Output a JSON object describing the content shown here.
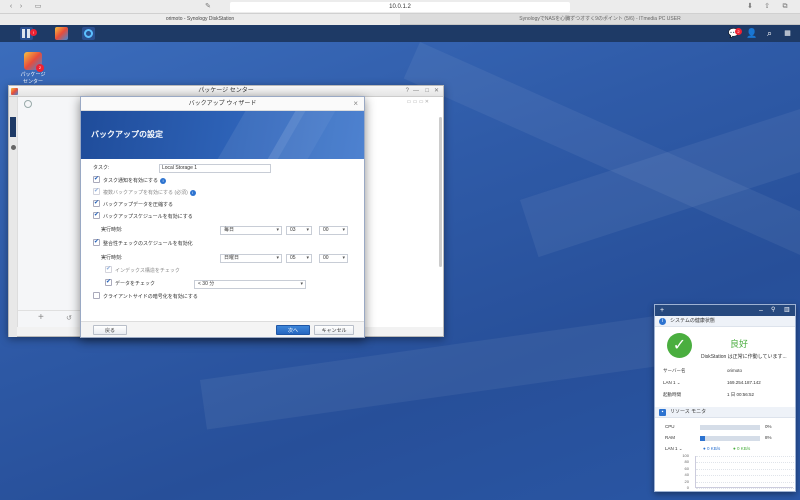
{
  "browser": {
    "address": "10.0.1.2",
    "tabs": [
      {
        "title": "orimoto - Synology DiskStation"
      },
      {
        "title": "SynologyでNASを心臓ずつオすく9のポイント (5/6) - ITmedia PC USER"
      }
    ]
  },
  "taskbar": {
    "notification_count": "2"
  },
  "desktop": {
    "package_icon_label": "パッケージ センター",
    "package_badge": "2"
  },
  "package_window": {
    "title": "パッケージ センター"
  },
  "wizard": {
    "title": "バックアップ ウィザード",
    "heading": "バックアップの設定",
    "task_label": "タスク:",
    "task_value": "Local Storage 1",
    "options": {
      "notify": "タスク通知を有効にする",
      "multi_version": "複数バックアップを有効にする (必須)",
      "compress": "バックアップデータを圧縮する",
      "schedule": "バックアップスケジュールを有効にする",
      "run_time_1": "実行時刻:",
      "integrity_schedule": "整合性チェックのスケジュールを有効化",
      "run_time_2": "実行時刻:",
      "index_check": "インデックス構造をチェック",
      "data_check": "データをチェック",
      "client_encrypt": "クライアントサイドの暗号化を有効にする"
    },
    "schedule_1": {
      "day": "毎日",
      "hour": "03",
      "minute": "00"
    },
    "schedule_2": {
      "day": "日曜日",
      "hour": "05",
      "minute": "00"
    },
    "data_check_limit": "< 30 分",
    "buttons": {
      "back": "戻る",
      "next": "次へ",
      "cancel": "キャンセル"
    }
  },
  "widget": {
    "health": {
      "title": "システムの健康状態",
      "status": "良好",
      "message": "DiskStation は正常に作動しています...",
      "server_label": "サーバー名",
      "server_value": "orimoto",
      "lan_label": "LAN 1 ⌄",
      "lan_value": "169.254.187.142",
      "uptime_label": "起動時間",
      "uptime_value": "1 日 00:56:52"
    },
    "resource": {
      "title": "リソース モニタ",
      "cpu_label": "CPU",
      "cpu_value": "0%",
      "cpu_fraction": 0.0,
      "ram_label": "RAM",
      "ram_value": "8%",
      "ram_fraction": 0.08,
      "lan_label": "LAN 1 ⌄",
      "upload": "0 KB/s",
      "download": "0 KB/s",
      "ticks": [
        "100",
        "80",
        "60",
        "40",
        "20",
        "0"
      ]
    }
  },
  "colors": {
    "accent": "#2d73d0",
    "health_good": "#4aae3f",
    "download": "#4aae3f"
  }
}
